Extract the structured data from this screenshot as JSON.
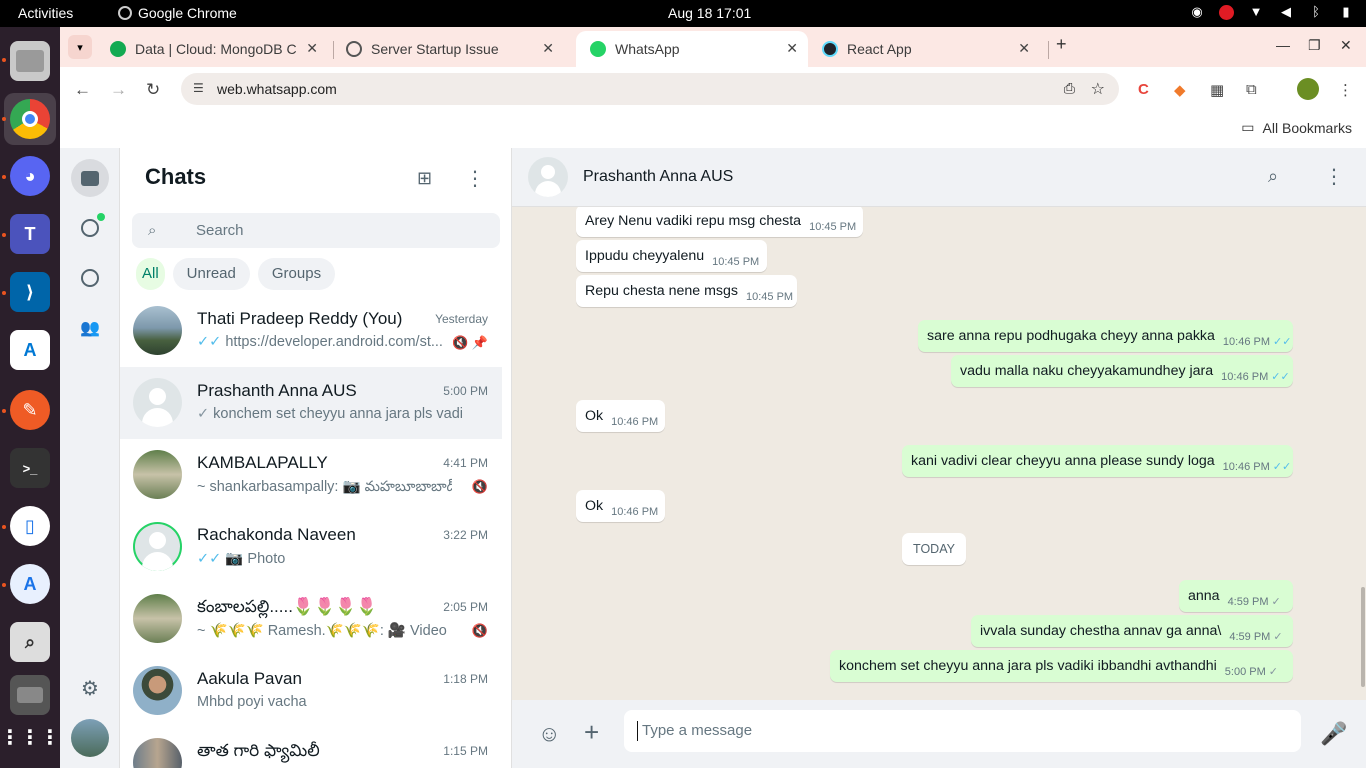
{
  "os": {
    "activities": "Activities",
    "app_name": "Google Chrome",
    "clock": "Aug 18  17:01"
  },
  "browser": {
    "tabs": [
      {
        "title": "Data | Cloud: MongoDB C",
        "icon": "mongodb-leaf-icon"
      },
      {
        "title": "Server Startup Issue",
        "icon": "openai-icon"
      },
      {
        "title": "WhatsApp",
        "icon": "whatsapp-icon"
      },
      {
        "title": "React App",
        "icon": "react-icon"
      }
    ],
    "url": "web.whatsapp.com",
    "all_bookmarks": "All Bookmarks"
  },
  "sidebar": {
    "title": "Chats",
    "search_placeholder": "Search",
    "filters": [
      "All",
      "Unread",
      "Groups"
    ],
    "chats": [
      {
        "name": "Thati Pradeep Reddy (You)",
        "time": "Yesterday",
        "preview": "https://developer.android.com/st...",
        "status": "double-tick-blue",
        "muted": true,
        "pinned": true,
        "avatar": "landscape"
      },
      {
        "name": "Prashanth Anna AUS",
        "time": "5:00 PM",
        "preview": "konchem set cheyyu anna jara pls vadiki ibbandhi avthandhi",
        "status": "single-tick",
        "muted": false,
        "pinned": false,
        "avatar": "default"
      },
      {
        "name": "KAMBALAPALLY",
        "time": "4:41 PM",
        "preview": "~ shankarbasampally: 📷 మహబూబాబాద్ జిల్లా",
        "status": "none",
        "muted": true,
        "pinned": false,
        "avatar": "signboard"
      },
      {
        "name": "Rachakonda Naveen",
        "time": "3:22 PM",
        "preview": "📷 Photo",
        "status": "double-tick-blue",
        "muted": false,
        "pinned": false,
        "avatar": "default-status"
      },
      {
        "name": "కంబాలపల్లి.....🌷🌷🌷🌷",
        "time": "2:05 PM",
        "preview": "~ 🌾🌾🌾 Ramesh.🌾🌾🌾: 🎥 Video",
        "status": "none",
        "muted": true,
        "pinned": false,
        "avatar": "signboard"
      },
      {
        "name": "Aakula Pavan",
        "time": "1:18 PM",
        "preview": "Mhbd poyi vacha",
        "status": "none",
        "muted": false,
        "pinned": false,
        "avatar": "person"
      },
      {
        "name": "తాత గారి ఫ్యామిలీ",
        "time": "1:15 PM",
        "preview": "",
        "status": "none",
        "muted": false,
        "pinned": false,
        "avatar": "group"
      }
    ]
  },
  "conversation": {
    "contact": "Prashanth Anna AUS",
    "day_label": "TODAY",
    "composer_placeholder": "Type a message",
    "messages": [
      {
        "dir": "in",
        "text": "Arey Nenu vadiki repu msg chesta",
        "time": "10:45 PM"
      },
      {
        "dir": "in",
        "text": "Ippudu cheyyalenu",
        "time": "10:45 PM"
      },
      {
        "dir": "in",
        "text": "Repu chesta nene msgs",
        "time": "10:45 PM"
      },
      {
        "dir": "out",
        "text": "sare anna repu podhugaka cheyy anna pakka",
        "time": "10:46 PM",
        "ticks": "read"
      },
      {
        "dir": "out",
        "text": "vadu malla naku cheyyakamundhey jara",
        "time": "10:46 PM",
        "ticks": "read"
      },
      {
        "dir": "in",
        "text": "Ok",
        "time": "10:46 PM"
      },
      {
        "dir": "out",
        "text": "kani vadivi clear cheyyu anna please sundy loga",
        "time": "10:46 PM",
        "ticks": "read"
      },
      {
        "dir": "in",
        "text": "Ok",
        "time": "10:46 PM"
      },
      {
        "dir": "out",
        "text": "anna",
        "time": "4:59 PM",
        "ticks": "sent"
      },
      {
        "dir": "out",
        "text": "ivvala sunday chestha annav ga anna\\",
        "time": "4:59 PM",
        "ticks": "sent"
      },
      {
        "dir": "out",
        "text": "konchem set cheyyu anna jara pls vadiki ibbandhi avthandhi",
        "time": "5:00 PM",
        "ticks": "sent"
      }
    ]
  },
  "colors": {
    "wa_green": "#008069",
    "bubble_out": "#d9fdd3",
    "read_tick": "#53bdeb"
  }
}
